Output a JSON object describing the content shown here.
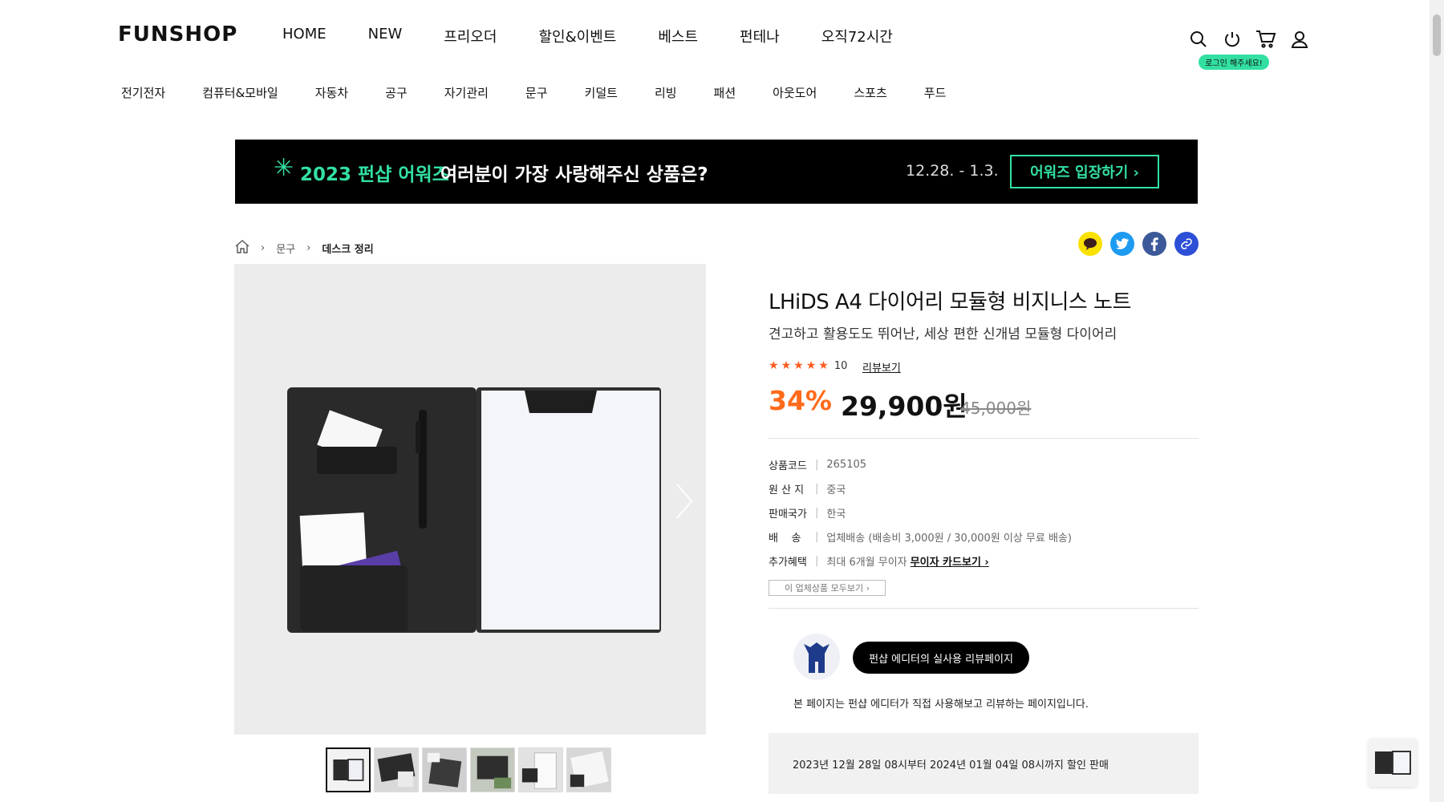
{
  "header": {
    "logo": "FUNSHOP",
    "gnb": [
      "HOME",
      "NEW",
      "프리오더",
      "할인&이벤트",
      "베스트",
      "펀테나",
      "오직72시간"
    ],
    "login_badge": "로그인 해주세요!",
    "icons": [
      "search-icon",
      "power-icon",
      "cart-icon",
      "user-icon"
    ]
  },
  "categories": [
    "전기전자",
    "컴퓨터&모바일",
    "자동차",
    "공구",
    "자기관리",
    "문구",
    "키덜트",
    "리빙",
    "패션",
    "아웃도어",
    "스포츠",
    "푸드"
  ],
  "banner": {
    "highlight": "2023 펀샵 어워즈",
    "text": "여러분이 가장 사랑해주신 상품은?",
    "date": "12.28. - 1.3.",
    "button": "어워즈 입장하기 ›"
  },
  "breadcrumb": {
    "items": [
      "문구",
      "데스크 정리"
    ]
  },
  "product": {
    "title": "LHiDS A4 다이어리 모듈형 비지니스 노트",
    "subtitle": "견고하고 활용도도 뛰어난, 세상 편한 신개념 모듈형 다이어리",
    "rating_count": "10",
    "rating_stars": 5,
    "review_link": "리뷰보기",
    "discount": "34%",
    "price": "29,900원",
    "original_price": "45,000원",
    "specs": [
      {
        "key": "상품코드",
        "value": "265105"
      },
      {
        "key": "원 산 지",
        "value": "중국"
      },
      {
        "key": "판매국가",
        "value": "한국"
      },
      {
        "key": "배    송",
        "value": "업체배송 (배송비 3,000원 / 30,000원 이상 무료 배송)"
      },
      {
        "key": "추가혜택",
        "value": "최대 6개월 무이자",
        "link": "무이자 카드보기 ›"
      }
    ],
    "all_products_button": "이 업체상품 모두보기 ›",
    "editor_button": "펀샵 에디터의 실사용 리뷰페이지",
    "editor_note": "본 페이지는 펀샵 에디터가 직접 사용해보고 리뷰하는 페이지입니다.",
    "sale_period": "2023년 12월 28일 08시부터 2024년 01월 04일 08시까지 할인 판매"
  },
  "colors": {
    "accent_green": "#33e0a1",
    "discount_orange": "#ff6b1a",
    "kakao": "#fae100",
    "twitter": "#1d9bf0",
    "facebook": "#3b5998",
    "link_blue": "#2c4fd6"
  }
}
